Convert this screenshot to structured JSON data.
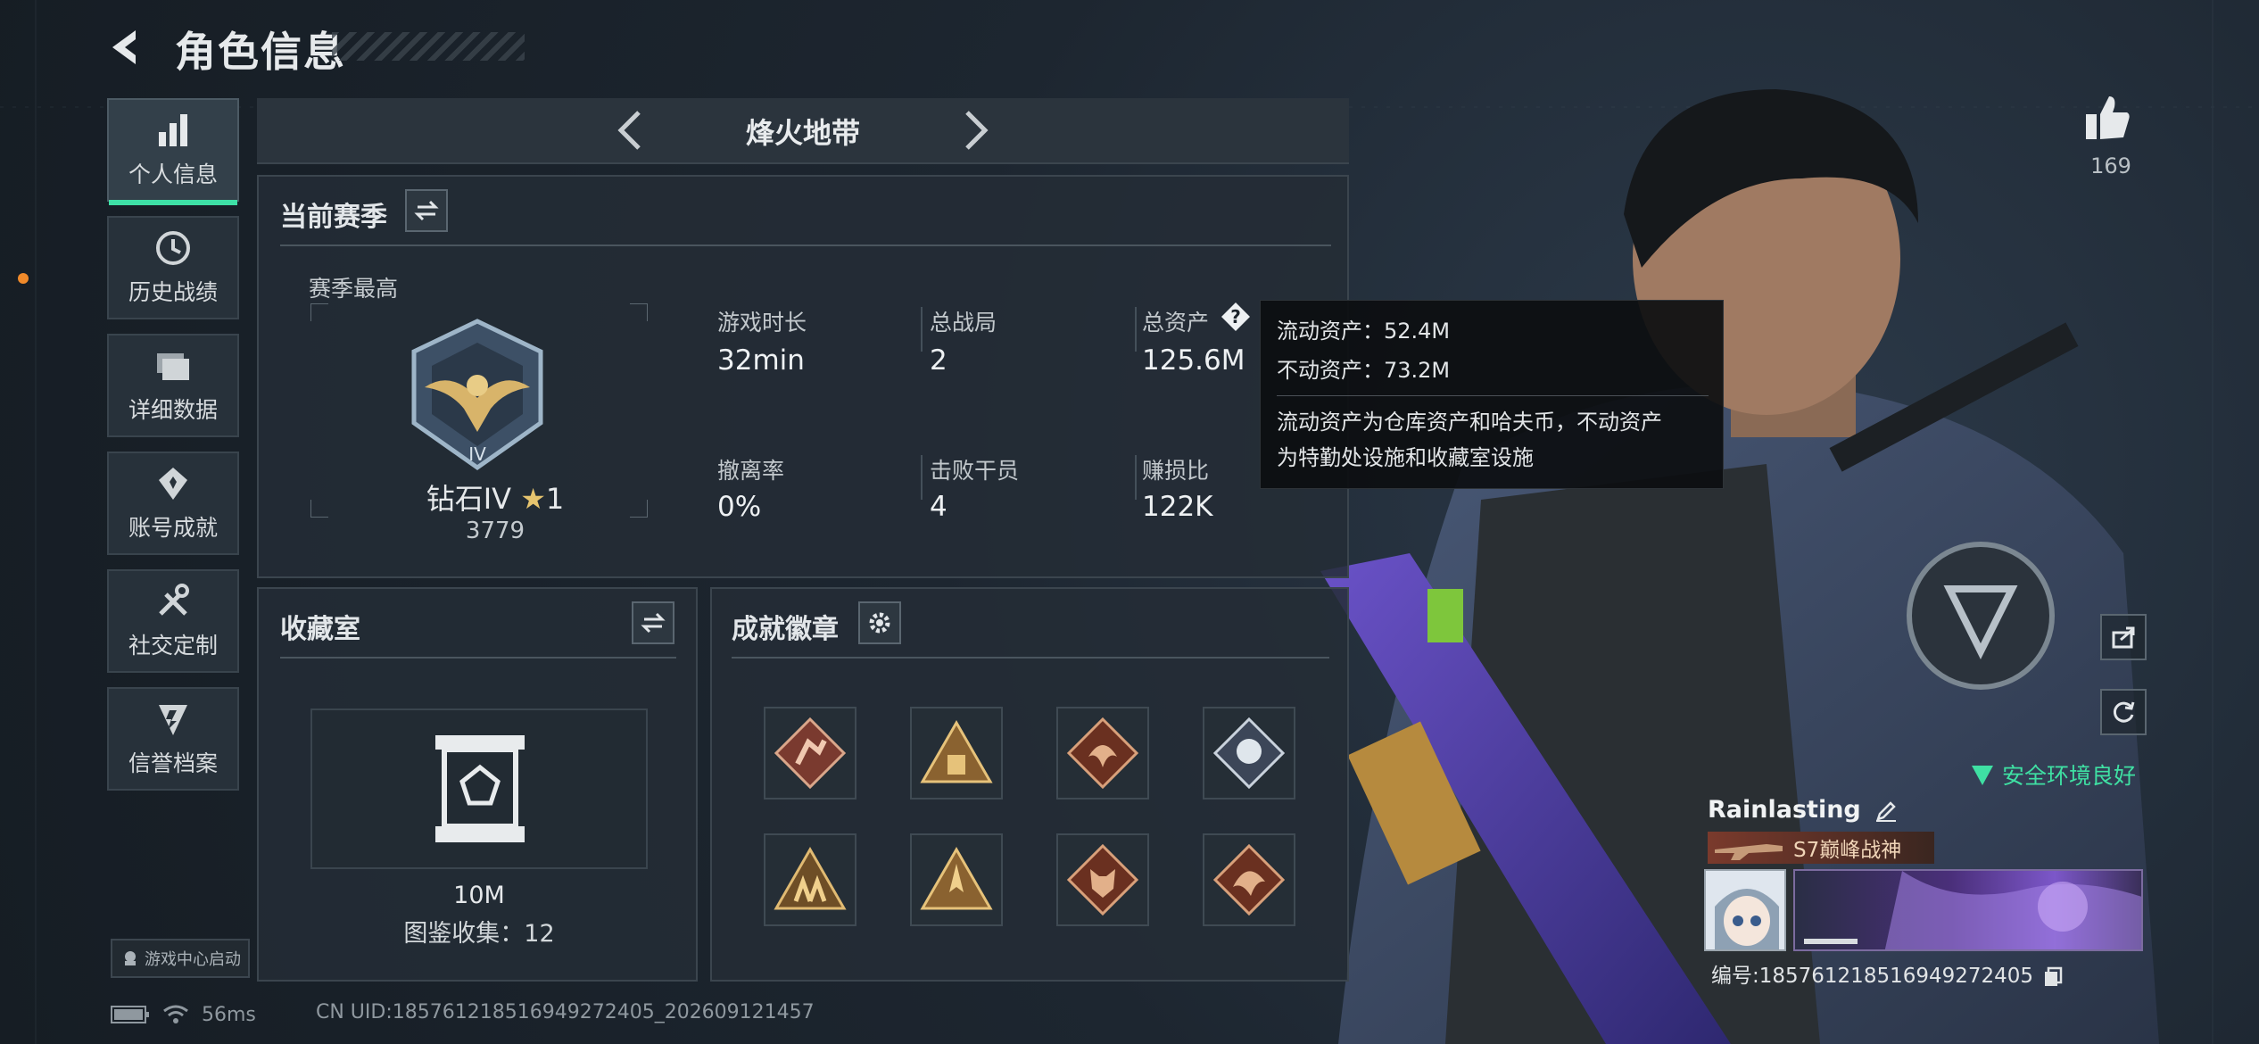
{
  "header": {
    "title": "角色信息"
  },
  "sidebar": {
    "items": [
      {
        "label": "个人信息",
        "icon": "bar-chart-icon",
        "active": true
      },
      {
        "label": "历史战绩",
        "icon": "history-icon"
      },
      {
        "label": "详细数据",
        "icon": "folder-icon"
      },
      {
        "label": "账号成就",
        "icon": "achievement-icon"
      },
      {
        "label": "社交定制",
        "icon": "tools-icon"
      },
      {
        "label": "信誉档案",
        "icon": "shield-icon"
      }
    ],
    "launch_label": "游戏中心启动"
  },
  "map_selector": {
    "name": "烽火地带"
  },
  "season": {
    "title": "当前赛季",
    "best_label": "赛季最高",
    "rank_name": "钻石IV",
    "rank_stars": "1",
    "rank_score": "3779",
    "stats": [
      {
        "label": "游戏时长",
        "value": "32min"
      },
      {
        "label": "总战局",
        "value": "2"
      },
      {
        "label": "总资产",
        "value": "125.6M"
      },
      {
        "label": "撤离率",
        "value": "0%"
      },
      {
        "label": "击败干员",
        "value": "4"
      },
      {
        "label": "赚损比",
        "value": "122K"
      }
    ]
  },
  "tooltip": {
    "liquid": "流动资产：52.4M",
    "fixed": "不动资产：73.2M",
    "desc_line1": "流动资产为仓库资产和哈夫币，不动资产",
    "desc_line2": "为特勤处设施和收藏室设施"
  },
  "collection": {
    "title": "收藏室",
    "value": "10M",
    "count": "图鉴收集：12"
  },
  "achievements": {
    "title": "成就徽章",
    "badges": [
      "climber-badge",
      "triangle-bag-badge",
      "dragon-badge",
      "rose-badge",
      "squad-badge",
      "rocket-badge",
      "wolf-badge",
      "dragon-badge-2"
    ]
  },
  "likes": {
    "count": "169"
  },
  "player": {
    "safety": "安全环境良好",
    "name": "Rainlasting",
    "title": "S7巅峰战神",
    "id_text": "编号:18576121851694927​2405"
  },
  "status": {
    "ping": "56ms",
    "uid": "CN UID:18576121851694927​2405_202609121457"
  },
  "colors": {
    "accent": "#3ee0a6",
    "panel": "#242d36",
    "border": "#3b454e"
  }
}
